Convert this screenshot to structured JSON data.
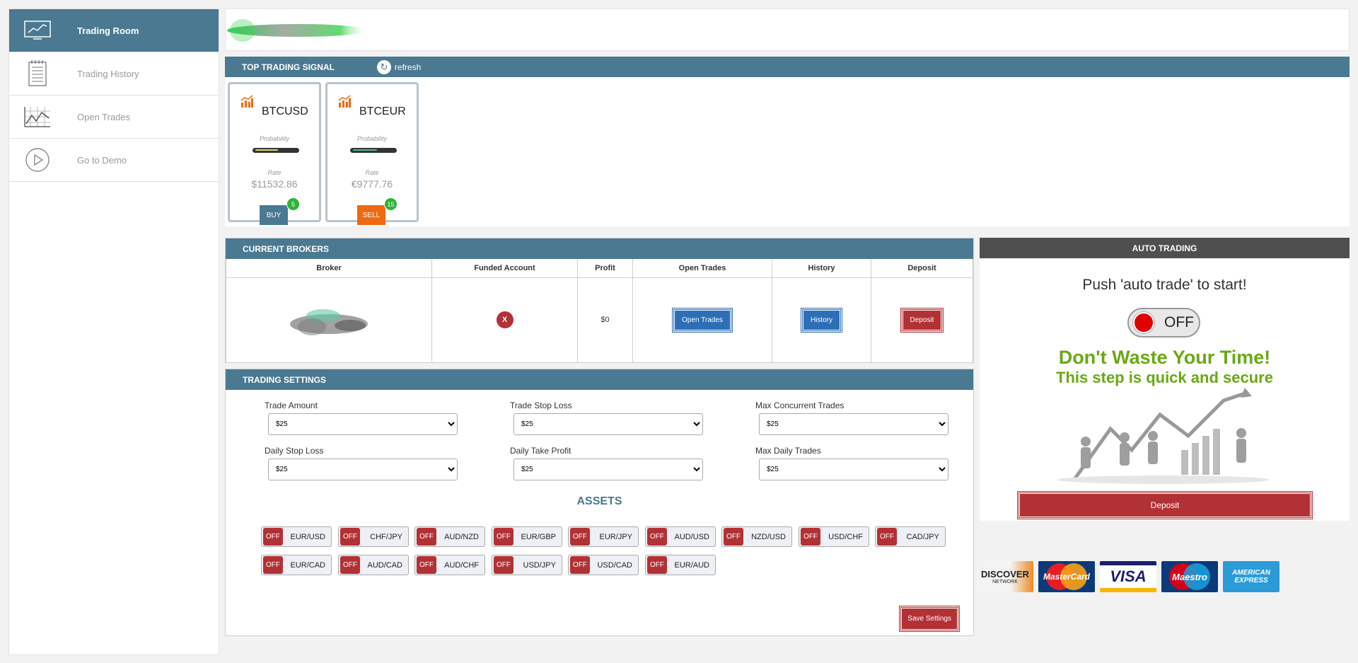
{
  "sidebar": {
    "items": [
      {
        "label": "Trading Room",
        "icon": "line-chart-icon",
        "active": true
      },
      {
        "label": "Trading History",
        "icon": "notepad-icon",
        "active": false
      },
      {
        "label": "Open Trades",
        "icon": "trade-graph-icon",
        "active": false
      },
      {
        "label": "Go to Demo",
        "icon": "play-icon",
        "active": false
      }
    ]
  },
  "signals": {
    "title": "TOP TRADING SIGNAL",
    "refresh_label": "refresh",
    "cards": [
      {
        "pair": "BTCUSD",
        "probability_label": "Probability",
        "rate_label": "Rate",
        "rate": "$11532.86",
        "action": "BUY",
        "count": "5",
        "action_color": "#4a7991",
        "bar_color": "#e8d35a"
      },
      {
        "pair": "BTCEUR",
        "probability_label": "Probability",
        "rate_label": "Rate",
        "rate": "€9777.76",
        "action": "SELL",
        "count": "15",
        "action_color": "#ee6a12",
        "bar_color": "#4fb8a0"
      }
    ]
  },
  "brokers": {
    "title": "CURRENT BROKERS",
    "columns": [
      "Broker",
      "Funded Account",
      "Profit",
      "Open Trades",
      "History",
      "Deposit"
    ],
    "row": {
      "funded": "X",
      "profit": "$0",
      "open_trades_btn": "Open Trades",
      "history_btn": "History",
      "deposit_btn": "Deposit"
    }
  },
  "settings": {
    "title": "TRADING SETTINGS",
    "fields": [
      {
        "label": "Trade Amount",
        "value": "$25"
      },
      {
        "label": "Trade Stop Loss",
        "value": "$25"
      },
      {
        "label": "Max Concurrent Trades",
        "value": "$25"
      },
      {
        "label": "Daily Stop Loss",
        "value": "$25"
      },
      {
        "label": "Daily Take Profit",
        "value": "$25"
      },
      {
        "label": "Max Daily Trades",
        "value": "$25"
      }
    ],
    "assets_title": "ASSETS",
    "off_label": "OFF",
    "assets": [
      "EUR/USD",
      "CHF/JPY",
      "AUD/NZD",
      "EUR/GBP",
      "EUR/JPY",
      "AUD/USD",
      "NZD/USD",
      "USD/CHF",
      "CAD/JPY",
      "EUR/CAD",
      "AUD/CAD",
      "AUD/CHF",
      "USD/JPY",
      "USD/CAD",
      "EUR/AUD"
    ],
    "save_label": "Save Settings"
  },
  "auto_trading": {
    "title": "AUTO TRADING",
    "message": "Push 'auto trade' to start!",
    "toggle_state": "OFF",
    "promo_line1": "Don't Waste Your Time!",
    "promo_line2": "This step is quick and secure",
    "deposit_label": "Deposit"
  },
  "payment_cards": [
    {
      "name": "DISCOVER",
      "sub": "NETWORK"
    },
    {
      "name": "MasterCard",
      "sub": ""
    },
    {
      "name": "VISA",
      "sub": ""
    },
    {
      "name": "Maestro",
      "sub": ""
    },
    {
      "name": "AMERICAN",
      "sub": "EXPRESS"
    }
  ],
  "colors": {
    "header_blue": "#4a7991",
    "danger_red": "#b23135",
    "button_blue": "#2d6fb6",
    "promo_green": "#6aa815"
  }
}
